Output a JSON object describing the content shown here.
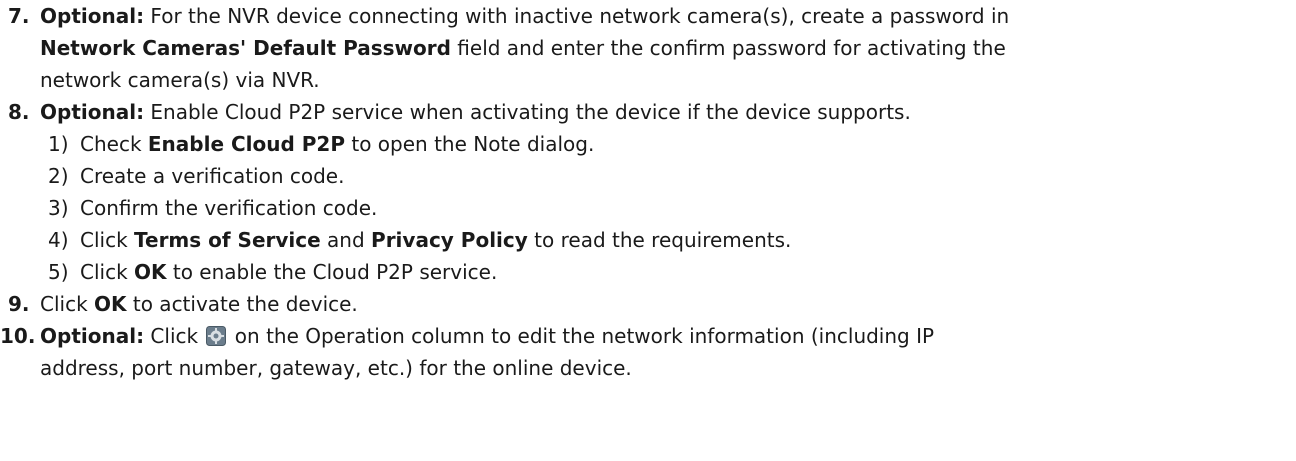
{
  "steps": [
    {
      "num": "7.",
      "lines": [
        [
          "Optional:",
          " For the NVR device connecting with inactive network camera(s), create a password in"
        ],
        [
          "Network Cameras' Default Password",
          " field and enter the confirm password for activating the"
        ],
        [
          "",
          "network camera(s) via NVR."
        ]
      ]
    },
    {
      "num": "8.",
      "lead_bold": "Optional:",
      "lead_text": " Enable Cloud P2P service when activating the device if the device supports.",
      "substeps": [
        {
          "num": "1)",
          "pre": "Check ",
          "bold": "Enable Cloud P2P",
          "post": " to open the Note dialog."
        },
        {
          "num": "2)",
          "pre": "Create a verification code.",
          "bold": "",
          "post": ""
        },
        {
          "num": "3)",
          "pre": "Confirm the verification code.",
          "bold": "",
          "post": ""
        },
        {
          "num": "4)",
          "pre": "Click ",
          "bold": "Terms of Service",
          "mid": " and ",
          "bold2": "Privacy Policy",
          "post": " to read the requirements."
        },
        {
          "num": "5)",
          "pre": "Click ",
          "bold": "OK",
          "post": " to enable the Cloud P2P service."
        }
      ]
    },
    {
      "num": "9.",
      "pre": "Click ",
      "bold": "OK",
      "post": " to activate the device."
    },
    {
      "num": "10.",
      "lead_bold": "Optional:",
      "pre": " Click ",
      "icon": "edit-settings-icon",
      "post": " on the Operation column to edit the network information (including IP",
      "line2": "address, port number, gateway, etc.) for the online device."
    }
  ]
}
